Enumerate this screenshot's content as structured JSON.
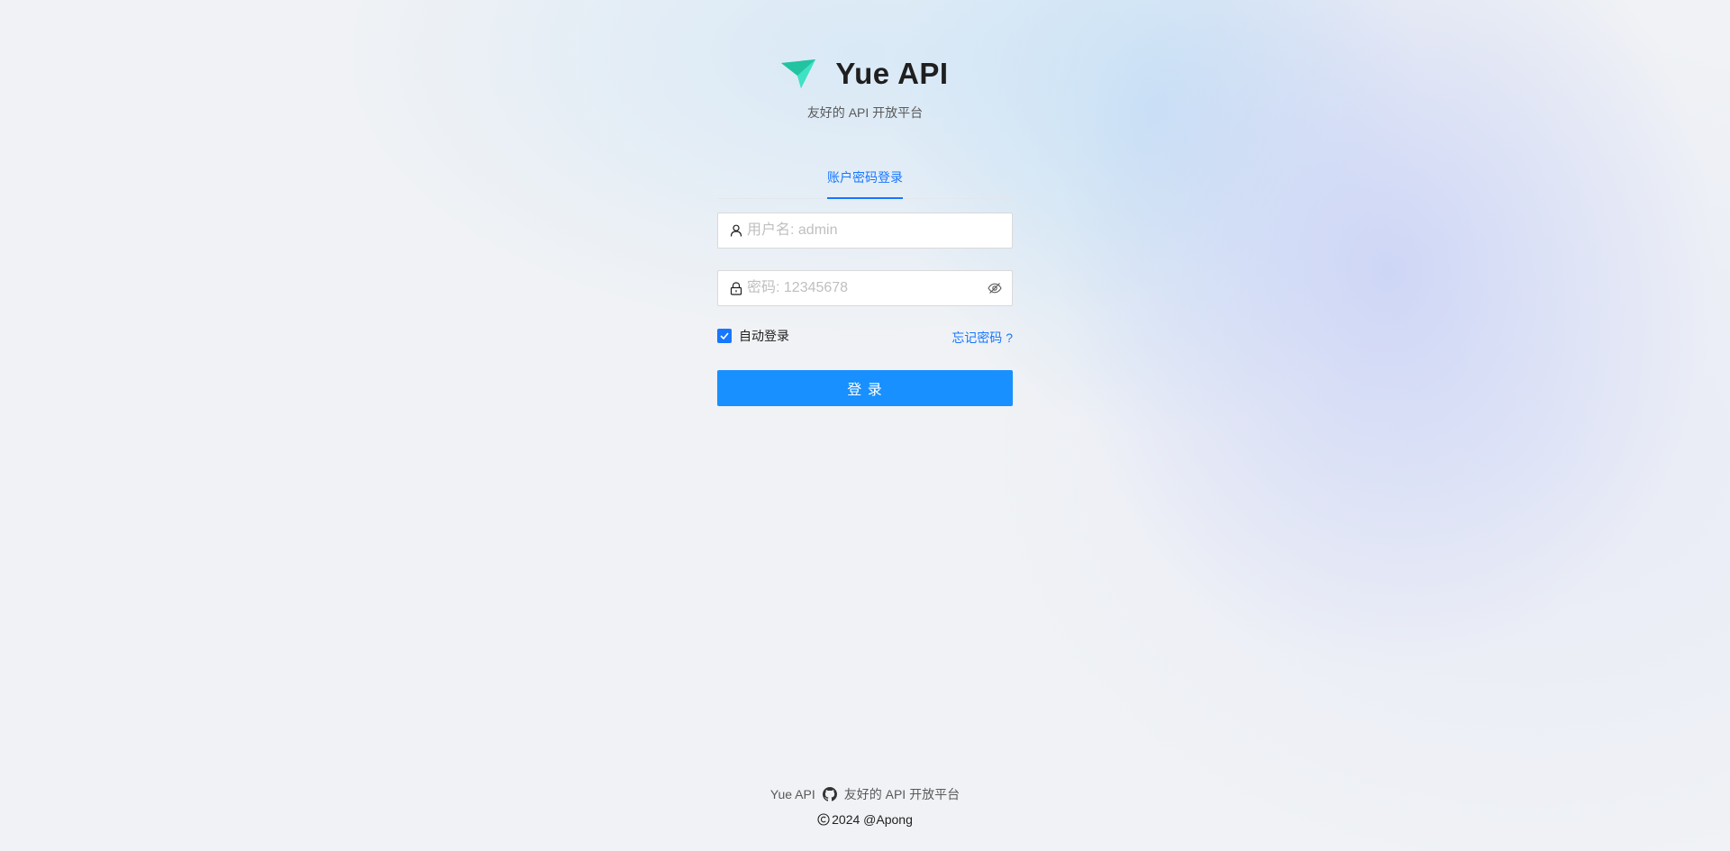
{
  "brand": {
    "title": "Yue API",
    "subtitle": "友好的 API 开放平台",
    "logo_icon": "paper-plane-logo",
    "logo_color": "#2fd6b4"
  },
  "login_tabs": {
    "active": "账户密码登录"
  },
  "form": {
    "username": {
      "icon": "user-icon",
      "placeholder": "用户名: admin",
      "value": ""
    },
    "password": {
      "icon": "lock-icon",
      "placeholder": "密码: 12345678",
      "value": "",
      "toggle_icon": "eye-invisible-icon"
    },
    "remember_label": "自动登录",
    "remember_checked": true,
    "forgot_label": "忘记密码 ?",
    "submit_label": "登 录"
  },
  "footer": {
    "left_link": "Yue API",
    "github_icon": "github-icon",
    "right_link": "友好的 API 开放平台",
    "copyright": "2024 @Apong"
  },
  "colors": {
    "primary": "#1677ff",
    "button": "#1890ff",
    "background": "#f0f2f5"
  }
}
